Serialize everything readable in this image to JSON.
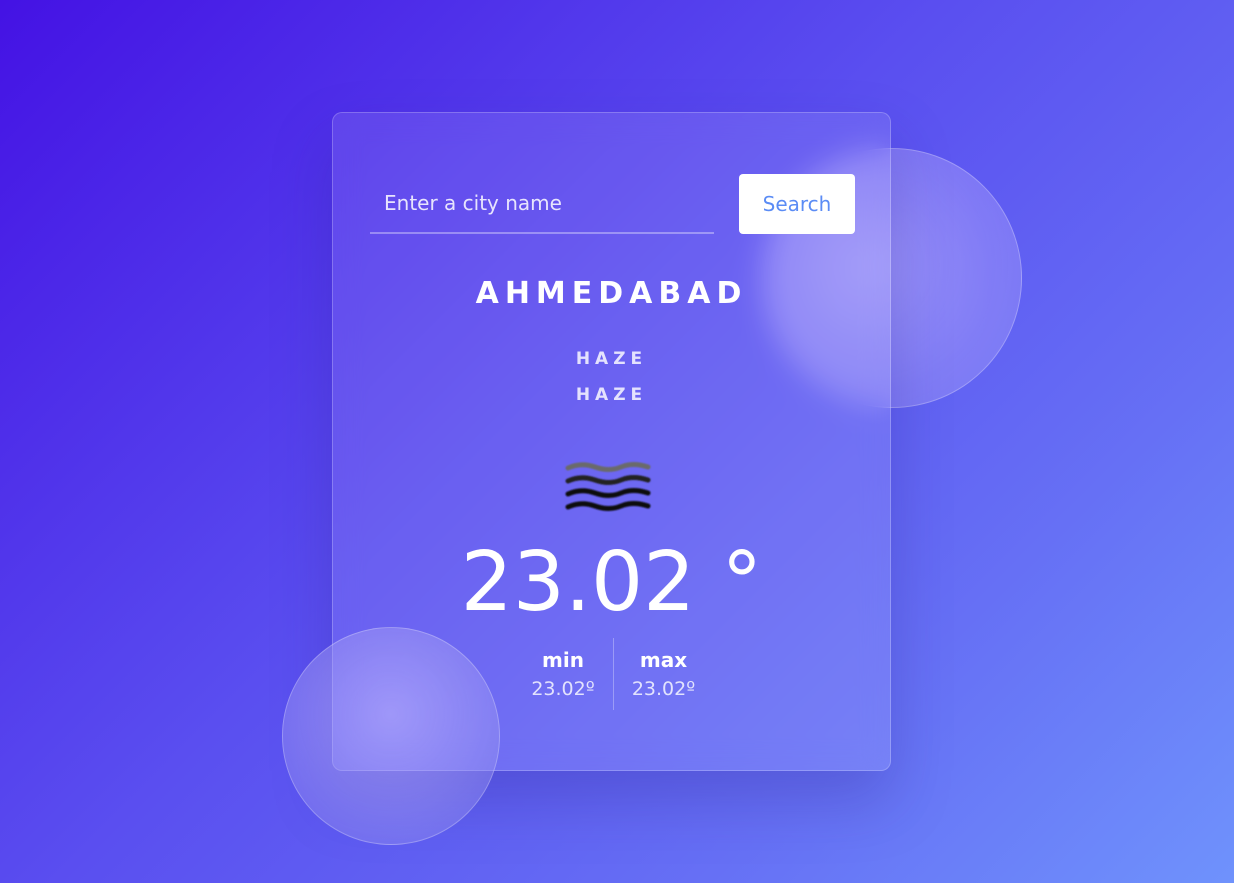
{
  "search": {
    "placeholder": "Enter a city name",
    "button_label": "Search"
  },
  "weather": {
    "city": "AHMEDABAD",
    "condition_main": "HAZE",
    "condition_description": "HAZE",
    "icon": "haze-icon",
    "temperature": "23.02 °",
    "min_label": "min",
    "min_value": "23.02º",
    "max_label": "max",
    "max_value": "23.02º"
  },
  "colors": {
    "accent": "#5b8cf5",
    "background_start": "#4412e4",
    "background_end": "#6f92fc"
  }
}
